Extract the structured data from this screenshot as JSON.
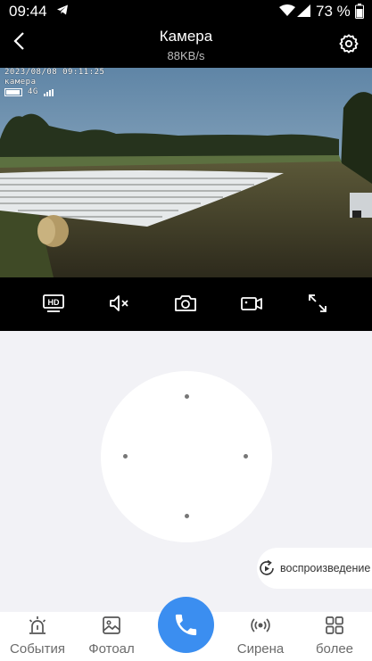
{
  "status_bar": {
    "time": "09:44",
    "battery_percent": "73 %"
  },
  "header": {
    "title": "Камера",
    "subtitle": "88KB/s"
  },
  "video": {
    "osd_datetime": "2023/08/08 09:11:25",
    "osd_name": "камера",
    "osd_network": "4G"
  },
  "controls": [
    {
      "icon": "hd-icon"
    },
    {
      "icon": "mute-icon"
    },
    {
      "icon": "camera-icon"
    },
    {
      "icon": "video-record-icon"
    },
    {
      "icon": "fullscreen-icon"
    }
  ],
  "playback": {
    "label": "воспроизведение"
  },
  "bottom_nav": {
    "events": "События",
    "photo": "Фотоал",
    "siren": "Сирена",
    "more": "более"
  },
  "colors": {
    "accent": "#3b8ef0",
    "header_bg": "#000000",
    "panel_bg": "#f2f2f6"
  }
}
